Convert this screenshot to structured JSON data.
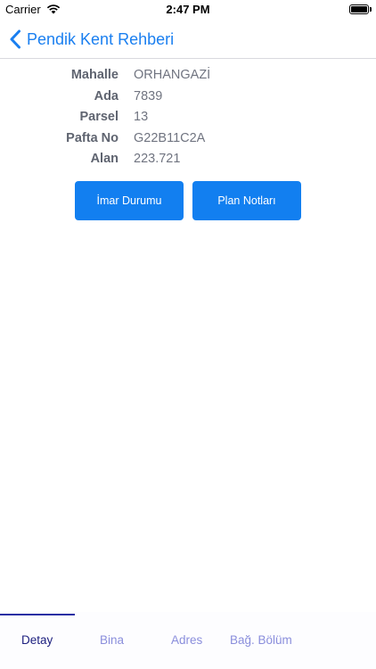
{
  "status_bar": {
    "carrier": "Carrier",
    "time": "2:47 PM",
    "battery_level": 1.0
  },
  "nav": {
    "back_label": "Pendik Kent Rehberi"
  },
  "info_rows": [
    {
      "label": "Mahalle",
      "value": "ORHANGAZİ"
    },
    {
      "label": "Ada",
      "value": "7839"
    },
    {
      "label": "Parsel",
      "value": "13"
    },
    {
      "label": "Pafta No",
      "value": "G22B11C2A"
    },
    {
      "label": "Alan",
      "value": "223.721"
    }
  ],
  "buttons": {
    "imar": "İmar Durumu",
    "plan": "Plan Notları"
  },
  "tabs": [
    {
      "label": "Detay",
      "active": true
    },
    {
      "label": "Bina",
      "active": false
    },
    {
      "label": "Adres",
      "active": false
    },
    {
      "label": "Bağ. Bölüm",
      "active": false
    }
  ],
  "colors": {
    "accent": "#127ff0",
    "tab_active": "#1e2180",
    "tab_inactive": "#8a8edc",
    "label": "#5f6470",
    "value": "#707480"
  }
}
